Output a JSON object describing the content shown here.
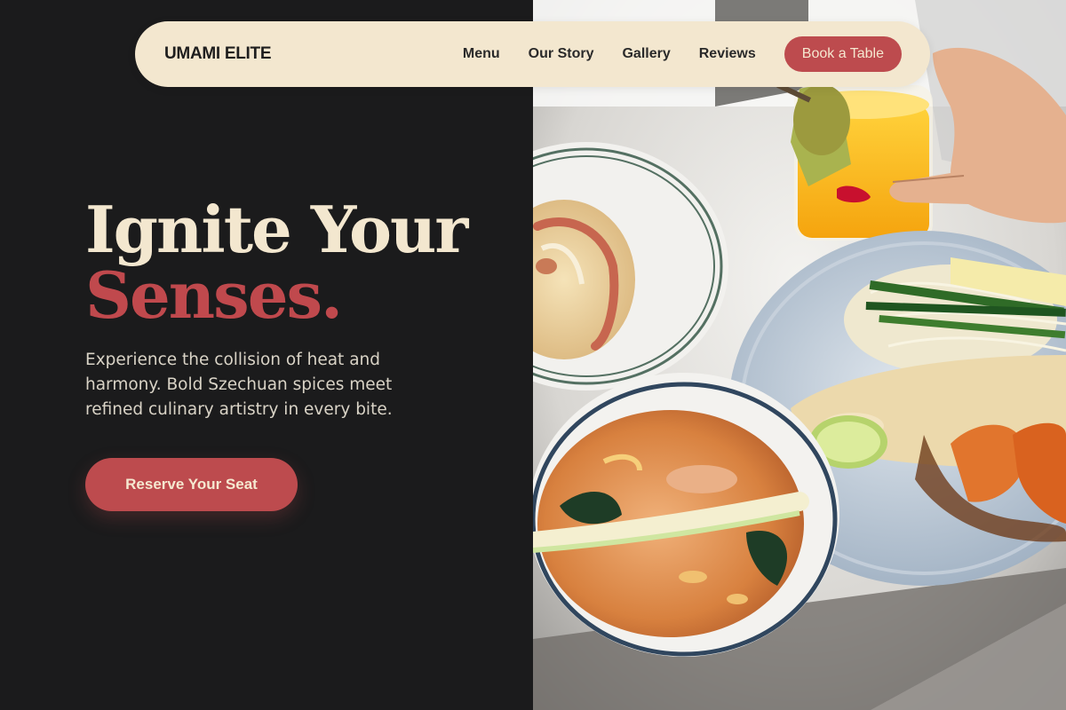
{
  "nav": {
    "brand": "UMAMI ELITE",
    "links": [
      "Menu",
      "Our Story",
      "Gallery",
      "Reviews"
    ],
    "cta": "Book a Table"
  },
  "hero": {
    "title_line_1": "Ignite Your",
    "title_line_2": "Senses.",
    "description": "Experience the collision of heat and harmony. Bold Szechuan spices meet refined culinary artistry in every bite.",
    "cta": "Reserve Your Seat"
  },
  "colors": {
    "background": "#1b1b1c",
    "cream": "#f3e7cf",
    "accent": "#bd4b4e",
    "text_muted": "#d9d3c6"
  },
  "image": {
    "subject": "food-photograph"
  }
}
